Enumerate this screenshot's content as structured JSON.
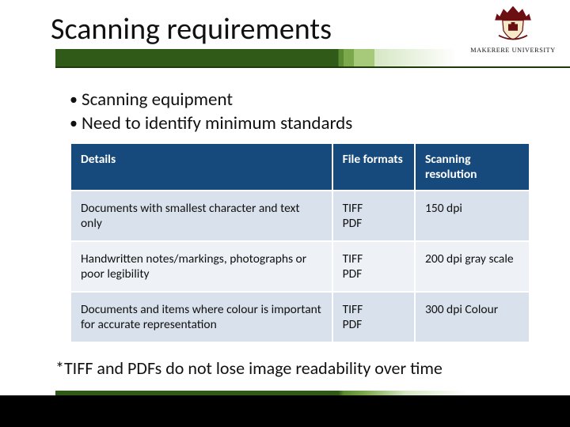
{
  "title": "Scanning requirements",
  "logo_caption": "MAKERERE UNIVERSITY",
  "bullets": [
    "Scanning equipment",
    "Need to identify minimum standards"
  ],
  "table": {
    "headers": {
      "details": "Details",
      "format": "File formats",
      "resolution": "Scanning resolution"
    },
    "rows": [
      {
        "details": "Documents with smallest character and text only",
        "format": "TIFF\nPDF",
        "resolution": "150 dpi"
      },
      {
        "details": "Handwritten notes/markings, photographs or poor legibility",
        "format": "TIFF\nPDF",
        "resolution": "200 dpi gray scale"
      },
      {
        "details": "Documents and items where colour is important for accurate representation",
        "format": "TIFF\nPDF",
        "resolution": "300 dpi Colour"
      }
    ]
  },
  "footnote": "*TIFF and PDFs do not lose image readability over time"
}
